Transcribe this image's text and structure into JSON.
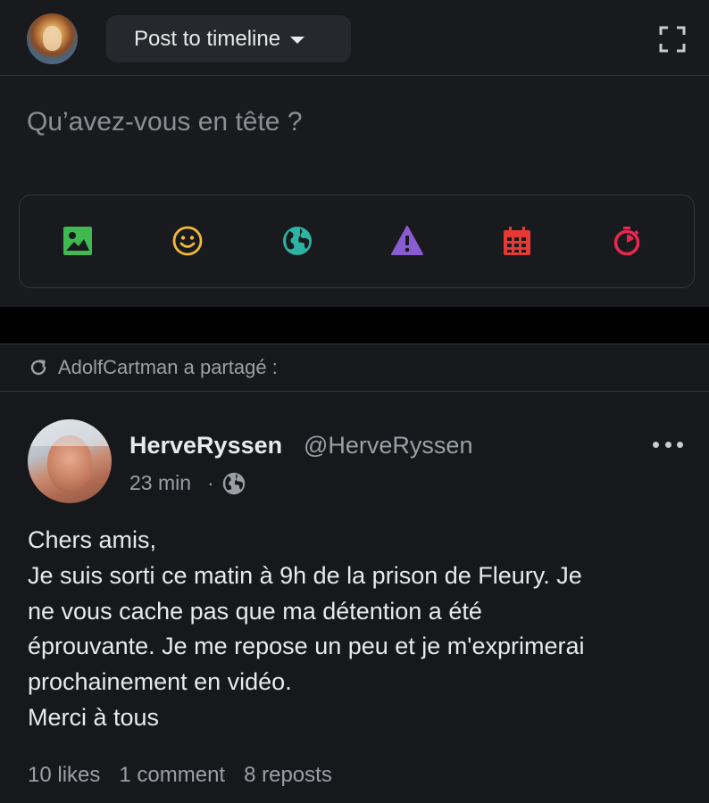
{
  "composer": {
    "visibility_label": "Post to timeline",
    "placeholder": "Qu’avez-vous en tête ?",
    "tools": [
      {
        "icon": "image-icon",
        "color": "#3fb950"
      },
      {
        "icon": "emoji-icon",
        "color": "#f0b93a"
      },
      {
        "icon": "globe-icon",
        "color": "#2bb3a3"
      },
      {
        "icon": "warning-icon",
        "color": "#8a5cd1"
      },
      {
        "icon": "calendar-icon",
        "color": "#e53935"
      },
      {
        "icon": "timer-icon",
        "color": "#e8284f"
      }
    ]
  },
  "share": {
    "text": "AdolfCartman a partagé :"
  },
  "post": {
    "author_name": "HerveRyssen",
    "author_handle": "@HerveRyssen",
    "time": "23 min",
    "separator": "·",
    "body_lines": [
      "Chers amis,",
      "Je suis sorti ce matin à 9h de la prison de Fleury. Je",
      "ne vous cache pas que ma détention a été",
      "éprouvante. Je me repose un peu et je m'exprimerai",
      "prochainement en vidéo.",
      "Merci à tous"
    ],
    "stats": {
      "likes": "10 likes",
      "comments": "1 comment",
      "reposts": "8 reposts"
    }
  }
}
